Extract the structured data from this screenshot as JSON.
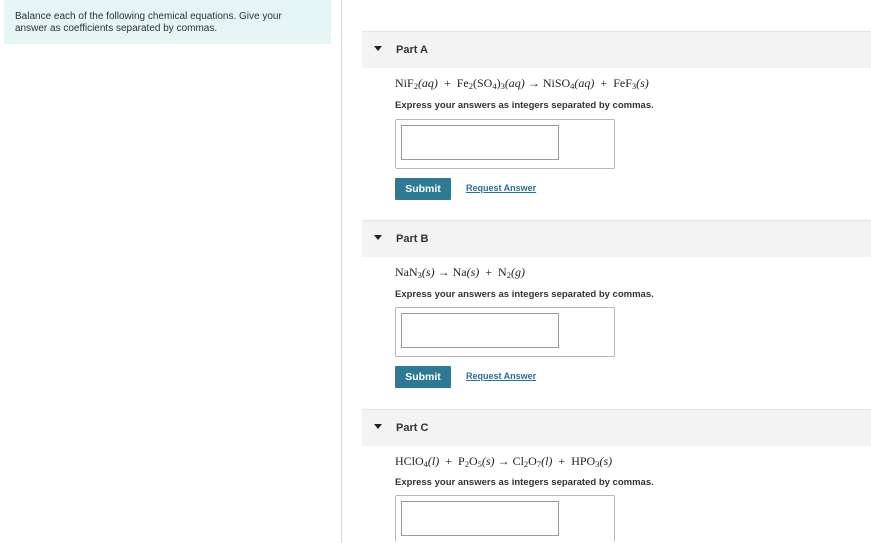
{
  "intro": {
    "text": "Balance each of the following chemical equations. Give your answer as coefficients separated by commas."
  },
  "parts": [
    {
      "title": "Part A",
      "instruction": "Express your answers as integers separated by commas.",
      "submit_label": "Submit",
      "request_label": "Request Answer",
      "answer_value": ""
    },
    {
      "title": "Part B",
      "instruction": "Express your answers as integers separated by commas.",
      "submit_label": "Submit",
      "request_label": "Request Answer",
      "answer_value": ""
    },
    {
      "title": "Part C",
      "instruction": "Express your answers as integers separated by commas.",
      "answer_value": ""
    }
  ],
  "equations": {
    "a": {
      "t1": "NiF",
      "s1": "2",
      "p1": "(aq)",
      "plus1": "+",
      "t2": "Fe",
      "s2": "2",
      "t3": "(SO",
      "s3": "4",
      "t4": ")",
      "s4": "3",
      "p2": "(aq)",
      "arrow": "→",
      "t5": "NiSO",
      "s5": "4",
      "p3": "(aq)",
      "plus2": "+",
      "t6": "FeF",
      "s6": "3",
      "p4": "(s)"
    },
    "b": {
      "t1": "NaN",
      "s1": "3",
      "p1": "(s)",
      "arrow": "→",
      "t2": "Na",
      "p2": "(s)",
      "plus1": "+",
      "t3": "N",
      "s3": "2",
      "p3": "(g)"
    },
    "c": {
      "t1": "HClO",
      "s1": "4",
      "p1": "(l)",
      "plus1": "+",
      "t2": "P",
      "s2": "2",
      "t3": "O",
      "s3": "5",
      "p2": "(s)",
      "arrow": "→",
      "t4": "Cl",
      "s4": "2",
      "t5": "O",
      "s5": "7",
      "p3": "(l)",
      "plus2": "+",
      "t6": "HPO",
      "s6": "3",
      "p4": "(s)"
    }
  },
  "colors": {
    "intro_bg": "#e5f4f4",
    "header_bg": "#f3f3f3",
    "submit_bg": "#2e7a93",
    "link": "#2a6f96"
  }
}
